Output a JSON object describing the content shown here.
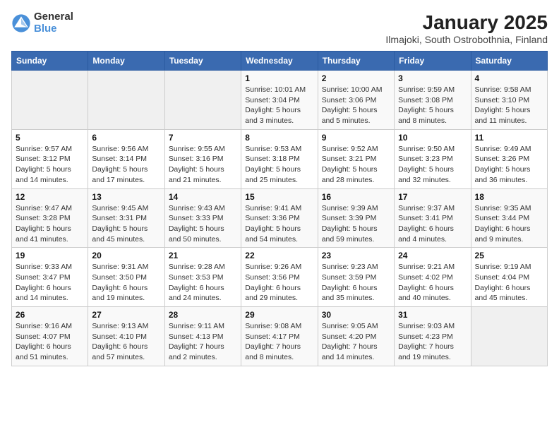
{
  "header": {
    "logo": {
      "line1": "General",
      "line2": "Blue"
    },
    "title": "January 2025",
    "subtitle": "Ilmajoki, South Ostrobothnia, Finland"
  },
  "weekdays": [
    "Sunday",
    "Monday",
    "Tuesday",
    "Wednesday",
    "Thursday",
    "Friday",
    "Saturday"
  ],
  "weeks": [
    [
      {
        "day": "",
        "info": ""
      },
      {
        "day": "",
        "info": ""
      },
      {
        "day": "",
        "info": ""
      },
      {
        "day": "1",
        "info": "Sunrise: 10:01 AM\nSunset: 3:04 PM\nDaylight: 5 hours and 3 minutes."
      },
      {
        "day": "2",
        "info": "Sunrise: 10:00 AM\nSunset: 3:06 PM\nDaylight: 5 hours and 5 minutes."
      },
      {
        "day": "3",
        "info": "Sunrise: 9:59 AM\nSunset: 3:08 PM\nDaylight: 5 hours and 8 minutes."
      },
      {
        "day": "4",
        "info": "Sunrise: 9:58 AM\nSunset: 3:10 PM\nDaylight: 5 hours and 11 minutes."
      }
    ],
    [
      {
        "day": "5",
        "info": "Sunrise: 9:57 AM\nSunset: 3:12 PM\nDaylight: 5 hours and 14 minutes."
      },
      {
        "day": "6",
        "info": "Sunrise: 9:56 AM\nSunset: 3:14 PM\nDaylight: 5 hours and 17 minutes."
      },
      {
        "day": "7",
        "info": "Sunrise: 9:55 AM\nSunset: 3:16 PM\nDaylight: 5 hours and 21 minutes."
      },
      {
        "day": "8",
        "info": "Sunrise: 9:53 AM\nSunset: 3:18 PM\nDaylight: 5 hours and 25 minutes."
      },
      {
        "day": "9",
        "info": "Sunrise: 9:52 AM\nSunset: 3:21 PM\nDaylight: 5 hours and 28 minutes."
      },
      {
        "day": "10",
        "info": "Sunrise: 9:50 AM\nSunset: 3:23 PM\nDaylight: 5 hours and 32 minutes."
      },
      {
        "day": "11",
        "info": "Sunrise: 9:49 AM\nSunset: 3:26 PM\nDaylight: 5 hours and 36 minutes."
      }
    ],
    [
      {
        "day": "12",
        "info": "Sunrise: 9:47 AM\nSunset: 3:28 PM\nDaylight: 5 hours and 41 minutes."
      },
      {
        "day": "13",
        "info": "Sunrise: 9:45 AM\nSunset: 3:31 PM\nDaylight: 5 hours and 45 minutes."
      },
      {
        "day": "14",
        "info": "Sunrise: 9:43 AM\nSunset: 3:33 PM\nDaylight: 5 hours and 50 minutes."
      },
      {
        "day": "15",
        "info": "Sunrise: 9:41 AM\nSunset: 3:36 PM\nDaylight: 5 hours and 54 minutes."
      },
      {
        "day": "16",
        "info": "Sunrise: 9:39 AM\nSunset: 3:39 PM\nDaylight: 5 hours and 59 minutes."
      },
      {
        "day": "17",
        "info": "Sunrise: 9:37 AM\nSunset: 3:41 PM\nDaylight: 6 hours and 4 minutes."
      },
      {
        "day": "18",
        "info": "Sunrise: 9:35 AM\nSunset: 3:44 PM\nDaylight: 6 hours and 9 minutes."
      }
    ],
    [
      {
        "day": "19",
        "info": "Sunrise: 9:33 AM\nSunset: 3:47 PM\nDaylight: 6 hours and 14 minutes."
      },
      {
        "day": "20",
        "info": "Sunrise: 9:31 AM\nSunset: 3:50 PM\nDaylight: 6 hours and 19 minutes."
      },
      {
        "day": "21",
        "info": "Sunrise: 9:28 AM\nSunset: 3:53 PM\nDaylight: 6 hours and 24 minutes."
      },
      {
        "day": "22",
        "info": "Sunrise: 9:26 AM\nSunset: 3:56 PM\nDaylight: 6 hours and 29 minutes."
      },
      {
        "day": "23",
        "info": "Sunrise: 9:23 AM\nSunset: 3:59 PM\nDaylight: 6 hours and 35 minutes."
      },
      {
        "day": "24",
        "info": "Sunrise: 9:21 AM\nSunset: 4:02 PM\nDaylight: 6 hours and 40 minutes."
      },
      {
        "day": "25",
        "info": "Sunrise: 9:19 AM\nSunset: 4:04 PM\nDaylight: 6 hours and 45 minutes."
      }
    ],
    [
      {
        "day": "26",
        "info": "Sunrise: 9:16 AM\nSunset: 4:07 PM\nDaylight: 6 hours and 51 minutes."
      },
      {
        "day": "27",
        "info": "Sunrise: 9:13 AM\nSunset: 4:10 PM\nDaylight: 6 hours and 57 minutes."
      },
      {
        "day": "28",
        "info": "Sunrise: 9:11 AM\nSunset: 4:13 PM\nDaylight: 7 hours and 2 minutes."
      },
      {
        "day": "29",
        "info": "Sunrise: 9:08 AM\nSunset: 4:17 PM\nDaylight: 7 hours and 8 minutes."
      },
      {
        "day": "30",
        "info": "Sunrise: 9:05 AM\nSunset: 4:20 PM\nDaylight: 7 hours and 14 minutes."
      },
      {
        "day": "31",
        "info": "Sunrise: 9:03 AM\nSunset: 4:23 PM\nDaylight: 7 hours and 19 minutes."
      },
      {
        "day": "",
        "info": ""
      }
    ]
  ]
}
